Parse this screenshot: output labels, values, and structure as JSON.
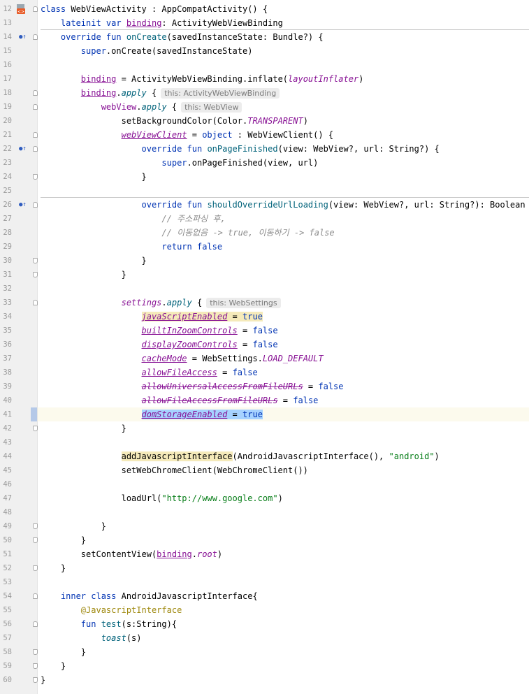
{
  "colors": {
    "keyword": "#0033b3",
    "function": "#00627a",
    "string": "#067d17",
    "comment": "#8c8c8c",
    "property": "#871094",
    "annotation": "#9e880d",
    "current_line": "#fcfaed",
    "highlight_yellow": "#f5eaba",
    "highlight_blue": "#a6d2ff"
  },
  "icons": {
    "kotlin_class": "kotlin-class-icon",
    "override": "override-method-icon"
  },
  "gutter": {
    "line_numbers": [
      "12",
      "13",
      "14",
      "15",
      "16",
      "17",
      "18",
      "19",
      "20",
      "21",
      "22",
      "23",
      "24",
      "25",
      "26",
      "27",
      "28",
      "29",
      "30",
      "31",
      "32",
      "33",
      "34",
      "35",
      "36",
      "37",
      "38",
      "39",
      "40",
      "41",
      "42",
      "43",
      "44",
      "45",
      "46",
      "47",
      "48",
      "49",
      "50",
      "51",
      "52",
      "53",
      "54",
      "55",
      "56",
      "57",
      "58",
      "59",
      "60"
    ]
  },
  "code": {
    "l12": {
      "kw_class": "class",
      "name": " WebViewActivity",
      "rest": " : AppCompatActivity() {"
    },
    "l13": {
      "kw": "lateinit var",
      "prop": "binding",
      "rest": ": ActivityWebViewBinding"
    },
    "l14": {
      "kw": "override fun",
      "fn": "onCreate",
      "rest": "(savedInstanceState: Bundle?) {"
    },
    "l15": {
      "kw": "super",
      "rest": ".onCreate(savedInstanceState)"
    },
    "l17": {
      "prop": "binding",
      "rest": " = ActivityWebViewBinding.inflate(",
      "arg": "layoutInflater",
      "end": ")"
    },
    "l18": {
      "prop": "binding",
      "dot": ".",
      "ext": "apply",
      "rest": " {",
      "hint": "this: ActivityWebViewBinding"
    },
    "l19": {
      "prop": "webView",
      "dot": ".",
      "ext": "apply",
      "rest": " {",
      "hint": "this: WebView"
    },
    "l20": {
      "rest": "setBackgroundColor(Color.",
      "static": "TRANSPARENT",
      "end": ")"
    },
    "l21": {
      "prop": "webViewClient",
      "rest": " = ",
      "kw": "object",
      "end": " : WebViewClient() {"
    },
    "l22": {
      "kw": "override fun",
      "fn": "onPageFinished",
      "rest": "(view: WebView?, url: String?) {"
    },
    "l23": {
      "kw": "super",
      "rest": ".onPageFinished(view, url)"
    },
    "l24": {
      "rest": "}"
    },
    "l26": {
      "kw": "override fun",
      "fn": "shouldOverrideUrlLoading",
      "rest": "(view: WebView?, url: String?): Boolean {"
    },
    "l27": {
      "comment": "// 주소파싱 후,"
    },
    "l28": {
      "comment": "// 이동없음 -> true, 이동하기 -> false"
    },
    "l29": {
      "kw": "return false"
    },
    "l30": {
      "rest": "}"
    },
    "l31": {
      "rest": "}"
    },
    "l33": {
      "prop": "settings",
      "dot": ".",
      "ext": "apply",
      "rest": " {",
      "hint": "this: WebSettings"
    },
    "l34": {
      "prop": "javaScriptEnabled",
      "rest": " = ",
      "kw": "true"
    },
    "l35": {
      "prop": "builtInZoomControls",
      "rest": " = ",
      "kw": "false"
    },
    "l36": {
      "prop": "displayZoomControls",
      "rest": " = ",
      "kw": "false"
    },
    "l37": {
      "prop": "cacheMode",
      "rest": " = WebSettings.",
      "static": "LOAD_DEFAULT"
    },
    "l38": {
      "prop": "allowFileAccess",
      "rest": " = ",
      "kw": "false"
    },
    "l39": {
      "prop": "allowUniversalAccessFromFileURLs",
      "rest": " = ",
      "kw": "false"
    },
    "l40": {
      "prop": "allowFileAccessFromFileURLs",
      "rest": " = ",
      "kw": "false"
    },
    "l41": {
      "prop": "domStorageEnabled",
      "rest": " = ",
      "kw": "true"
    },
    "l42": {
      "rest": "}"
    },
    "l44": {
      "fn": "addJavascriptInterface",
      "rest": "(AndroidJavascriptInterface(), ",
      "str": "\"android\"",
      "end": ")"
    },
    "l45": {
      "rest": "setWebChromeClient(WebChromeClient())"
    },
    "l47": {
      "rest": "loadUrl(",
      "str": "\"http://www.google.com\"",
      "end": ")"
    },
    "l49": {
      "rest": "}"
    },
    "l50": {
      "rest": "}"
    },
    "l51": {
      "rest": "setContentView(",
      "prop": "binding",
      "dot": ".",
      "root": "root",
      "end": ")"
    },
    "l52": {
      "rest": "}"
    },
    "l54": {
      "kw": "inner class",
      "rest": " AndroidJavascriptInterface{"
    },
    "l55": {
      "ann": "@JavascriptInterface"
    },
    "l56": {
      "kw": "fun",
      "fn": " test",
      "rest": "(s:String){"
    },
    "l57": {
      "ext": "toast",
      "rest": "(s)"
    },
    "l58": {
      "rest": "}"
    },
    "l59": {
      "rest": "}"
    },
    "l60": {
      "rest": "}"
    }
  }
}
